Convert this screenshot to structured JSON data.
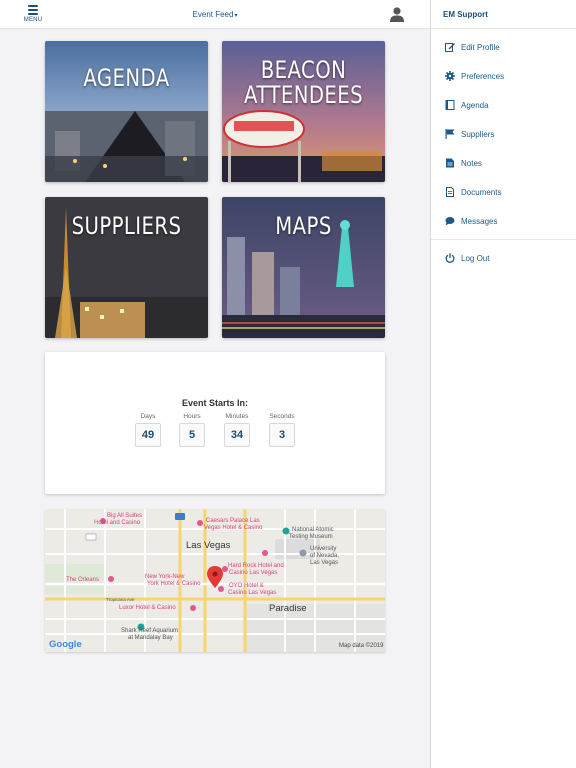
{
  "header": {
    "menu_label": "MENU",
    "title": "Event Feed"
  },
  "tiles": [
    {
      "title": "AGENDA"
    },
    {
      "title_line1": "BEACON",
      "title_line2": "ATTENDEES"
    },
    {
      "title": "SUPPLIERS"
    },
    {
      "title": "MAPS"
    }
  ],
  "countdown": {
    "heading": "Event Starts In:",
    "days_label": "Days",
    "days": "49",
    "hours_label": "Hours",
    "hours": "5",
    "minutes_label": "Minutes",
    "minutes": "34",
    "seconds_label": "Seconds",
    "seconds": "3"
  },
  "map": {
    "labels": {
      "big_all_suites": "Big All Suites",
      "hotel_casino": "Hotel and Casino",
      "caesars": "Caesars Palace Las",
      "caesars2": "Vegas Hotel & Casino",
      "natl_atomic": "National Atomic",
      "testing_museum": "Testing Museum",
      "las_vegas": "Las Vegas",
      "univ": "University",
      "of_nevada": "of Nevada,",
      "lv": "Las Vegas",
      "the_orleans": "The Orleans",
      "hard_rock": "Hard Rock Hotel and",
      "casino_lv": "Casino Las Vegas",
      "new_york": "New York-New",
      "york_hotel": "York Hotel & Casino",
      "oyo": "OYO Hotel &",
      "casino_lv2": "Casino Las Vegas",
      "luxor": "Luxor Hotel & Casino",
      "paradise": "Paradise",
      "shark_reef": "Shark Reef Aquarium",
      "mandalay": "at Mandalay Bay",
      "tropicana": "Tropicana Ave",
      "google": "Google",
      "map_data": "Map data ©2019"
    }
  },
  "side_menu": {
    "header": "EM Support",
    "items": [
      {
        "label": "Edit Profile",
        "icon": "edit-icon"
      },
      {
        "label": "Preferences",
        "icon": "gear-icon"
      },
      {
        "label": "Agenda",
        "icon": "book-icon"
      },
      {
        "label": "Suppliers",
        "icon": "flag-icon"
      },
      {
        "label": "Notes",
        "icon": "note-icon"
      },
      {
        "label": "Documents",
        "icon": "document-icon"
      },
      {
        "label": "Messages",
        "icon": "chat-icon"
      },
      {
        "label": "Log Out",
        "icon": "power-icon"
      }
    ]
  },
  "colors": {
    "accent": "#1b4e78",
    "link": "#1b5a8a",
    "map_pin": "#e53935"
  }
}
